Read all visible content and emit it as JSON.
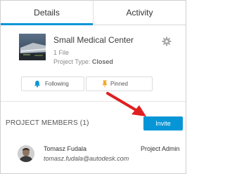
{
  "tabs": [
    {
      "label": "Details",
      "active": true
    },
    {
      "label": "Activity",
      "active": false
    }
  ],
  "project": {
    "name": "Small Medical Center",
    "files": "1 File",
    "type_label": "Project Type:",
    "type_value": "Closed",
    "thumbnail_icon": "building-photo-thumbnail",
    "settings_icon": "gear-icon"
  },
  "actions": {
    "following_label": "Following",
    "following_icon": "bell-icon",
    "pinned_label": "Pinned",
    "pinned_icon": "pin-icon"
  },
  "members": {
    "header": "PROJECT MEMBERS (1)",
    "invite_label": "Invite",
    "list": [
      {
        "name": "Tomasz Fudala",
        "email": "tomasz.fudala@autodesk.com",
        "role": "Project Admin",
        "avatar_icon": "avatar-photo"
      }
    ]
  },
  "colors": {
    "accent": "#0696d7",
    "annotation_arrow": "#e02020",
    "pin": "#f5a623"
  }
}
